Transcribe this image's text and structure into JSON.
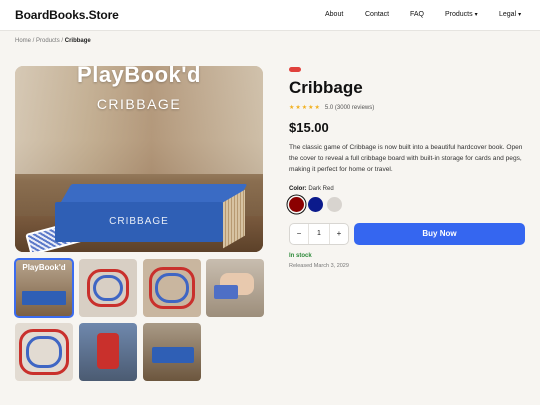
{
  "header": {
    "logo": "BoardBooks.Store",
    "nav": [
      {
        "label": "About",
        "caret": ""
      },
      {
        "label": "Contact",
        "caret": ""
      },
      {
        "label": "FAQ",
        "caret": ""
      },
      {
        "label": "Products",
        "caret": "▾"
      },
      {
        "label": "Legal",
        "caret": "▾"
      }
    ]
  },
  "breadcrumb": {
    "home": "Home",
    "sep1": " / ",
    "products": "Products",
    "sep2": " / ",
    "current": "Cribbage"
  },
  "gallery": {
    "main_image": {
      "overlay_title": "PlayBook'd",
      "overlay_subtitle": "CRIBBAGE",
      "spine_text": "CRIBBAGE"
    },
    "thumbnails": [
      {
        "name": "thumb-cover",
        "overlay_text": "PlayBook'd",
        "selected": true
      },
      {
        "name": "thumb-board-top",
        "selected": false
      },
      {
        "name": "thumb-board-angle",
        "selected": false
      },
      {
        "name": "thumb-hand-cards",
        "selected": false
      },
      {
        "name": "thumb-board-closeup",
        "selected": false
      },
      {
        "name": "thumb-pegs",
        "selected": false
      },
      {
        "name": "thumb-closed-book",
        "selected": false
      }
    ]
  },
  "product": {
    "title": "Cribbage",
    "stars": "★★★★★",
    "rating_text": "5.0 (3000 reviews)",
    "price": "$15.00",
    "description": "The classic game of Cribbage is now built into a beautiful hardcover book. Open the cover to reveal a full cribbage board with built-in storage for cards and pegs, making it perfect for home or travel.",
    "color_label": "Color:",
    "color_value": "Dark Red",
    "swatches": [
      {
        "name": "Dark Red",
        "hex": "#8b0000",
        "selected": true
      },
      {
        "name": "Navy",
        "hex": "#0b1a8c",
        "selected": false
      },
      {
        "name": "Light Gray",
        "hex": "#d8d4cf",
        "selected": false
      }
    ],
    "quantity": "1",
    "minus": "−",
    "plus": "+",
    "buy_label": "Buy Now",
    "stock": "In stock",
    "released": "Released March 3, 2029"
  },
  "colors": {
    "accent": "#3566f0",
    "badge": "#e0413c",
    "in_stock": "#2e8a3a",
    "book_blue": "#2f5fb5"
  }
}
